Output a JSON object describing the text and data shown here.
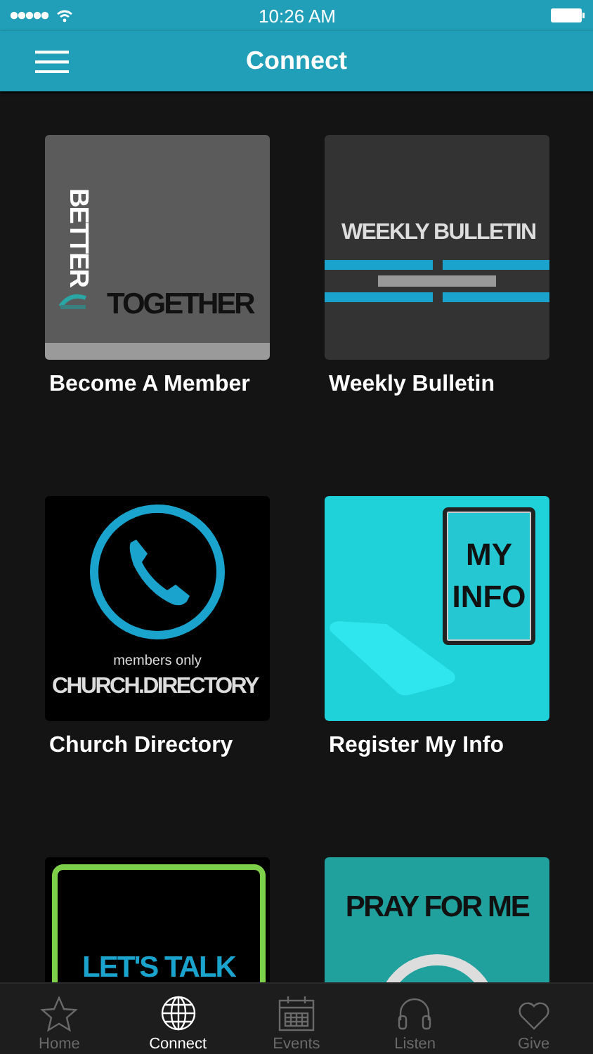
{
  "status_bar": {
    "time": "10:26 AM"
  },
  "nav_bar": {
    "title": "Connect"
  },
  "tiles": [
    {
      "kind": "better_together",
      "label": "Become A Member",
      "art": [
        "BETTER",
        "TOGETHER"
      ]
    },
    {
      "kind": "bulletin",
      "label": "Weekly Bulletin",
      "art": [
        "WEEKLY BULLETIN"
      ]
    },
    {
      "kind": "directory",
      "label": "Church Directory",
      "art": [
        "members only",
        "CHURCH.DIRECTORY"
      ]
    },
    {
      "kind": "my_info",
      "label": "Register My Info",
      "art": [
        "MY",
        "INFO"
      ]
    },
    {
      "kind": "lets_talk",
      "art": [
        "LET'S TALK"
      ]
    },
    {
      "kind": "pray",
      "art": [
        "PRAY FOR ME"
      ]
    }
  ],
  "tab_bar": [
    {
      "kind": "star",
      "label": "Home",
      "selected": false
    },
    {
      "kind": "globe",
      "label": "Connect",
      "selected": true
    },
    {
      "kind": "calendar",
      "label": "Events",
      "selected": false
    },
    {
      "kind": "headphones",
      "label": "Listen",
      "selected": false
    },
    {
      "kind": "heart",
      "label": "Give",
      "selected": false
    }
  ]
}
